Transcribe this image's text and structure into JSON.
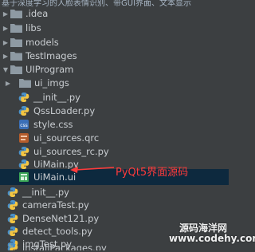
{
  "header": {
    "title": "基于深度学习的人脸表情识别、带GUI界面、文本显示"
  },
  "tree": [
    {
      "label": ".idea",
      "icon": "folder-icon",
      "expanded": false
    },
    {
      "label": "libs",
      "icon": "folder-icon",
      "expanded": false
    },
    {
      "label": "models",
      "icon": "folder-icon",
      "expanded": false
    },
    {
      "label": "TestImages",
      "icon": "folder-icon",
      "expanded": false
    },
    {
      "label": "UIProgram",
      "icon": "folder-icon",
      "expanded": true
    },
    {
      "label": "ui_imgs",
      "icon": "folder-icon",
      "expanded": false
    },
    {
      "label": "__init__.py",
      "icon": "python-file-icon"
    },
    {
      "label": "QssLoader.py",
      "icon": "python-file-icon"
    },
    {
      "label": "style.css",
      "icon": "css-file-icon"
    },
    {
      "label": "ui_sources.qrc",
      "icon": "qrc-file-icon"
    },
    {
      "label": "ui_sources_rc.py",
      "icon": "python-file-icon"
    },
    {
      "label": "UiMain.py",
      "icon": "python-file-icon"
    },
    {
      "label": "UiMain.ui",
      "icon": "ui-file-icon",
      "selected": true
    },
    {
      "label": "__init__.py",
      "icon": "python-file-icon"
    },
    {
      "label": "cameraTest.py",
      "icon": "python-file-icon"
    },
    {
      "label": "DenseNet121.py",
      "icon": "python-file-icon"
    },
    {
      "label": "detect_tools.py",
      "icon": "python-file-icon"
    },
    {
      "label": "imgTest.py",
      "icon": "python-file-icon"
    },
    {
      "label": "installPackages.py",
      "icon": "python-file-icon"
    }
  ],
  "annotation": {
    "text": "PyQt5界面源码",
    "color": "#ff3b3b"
  },
  "watermark": {
    "line1": "源码海洋网",
    "line2": "www.codehy.com"
  },
  "colors": {
    "background": "#3c3f41",
    "text": "#c9cdd1",
    "selection": "#0d293e",
    "folder": "#8e9aa3",
    "python": "#4a90c8"
  }
}
